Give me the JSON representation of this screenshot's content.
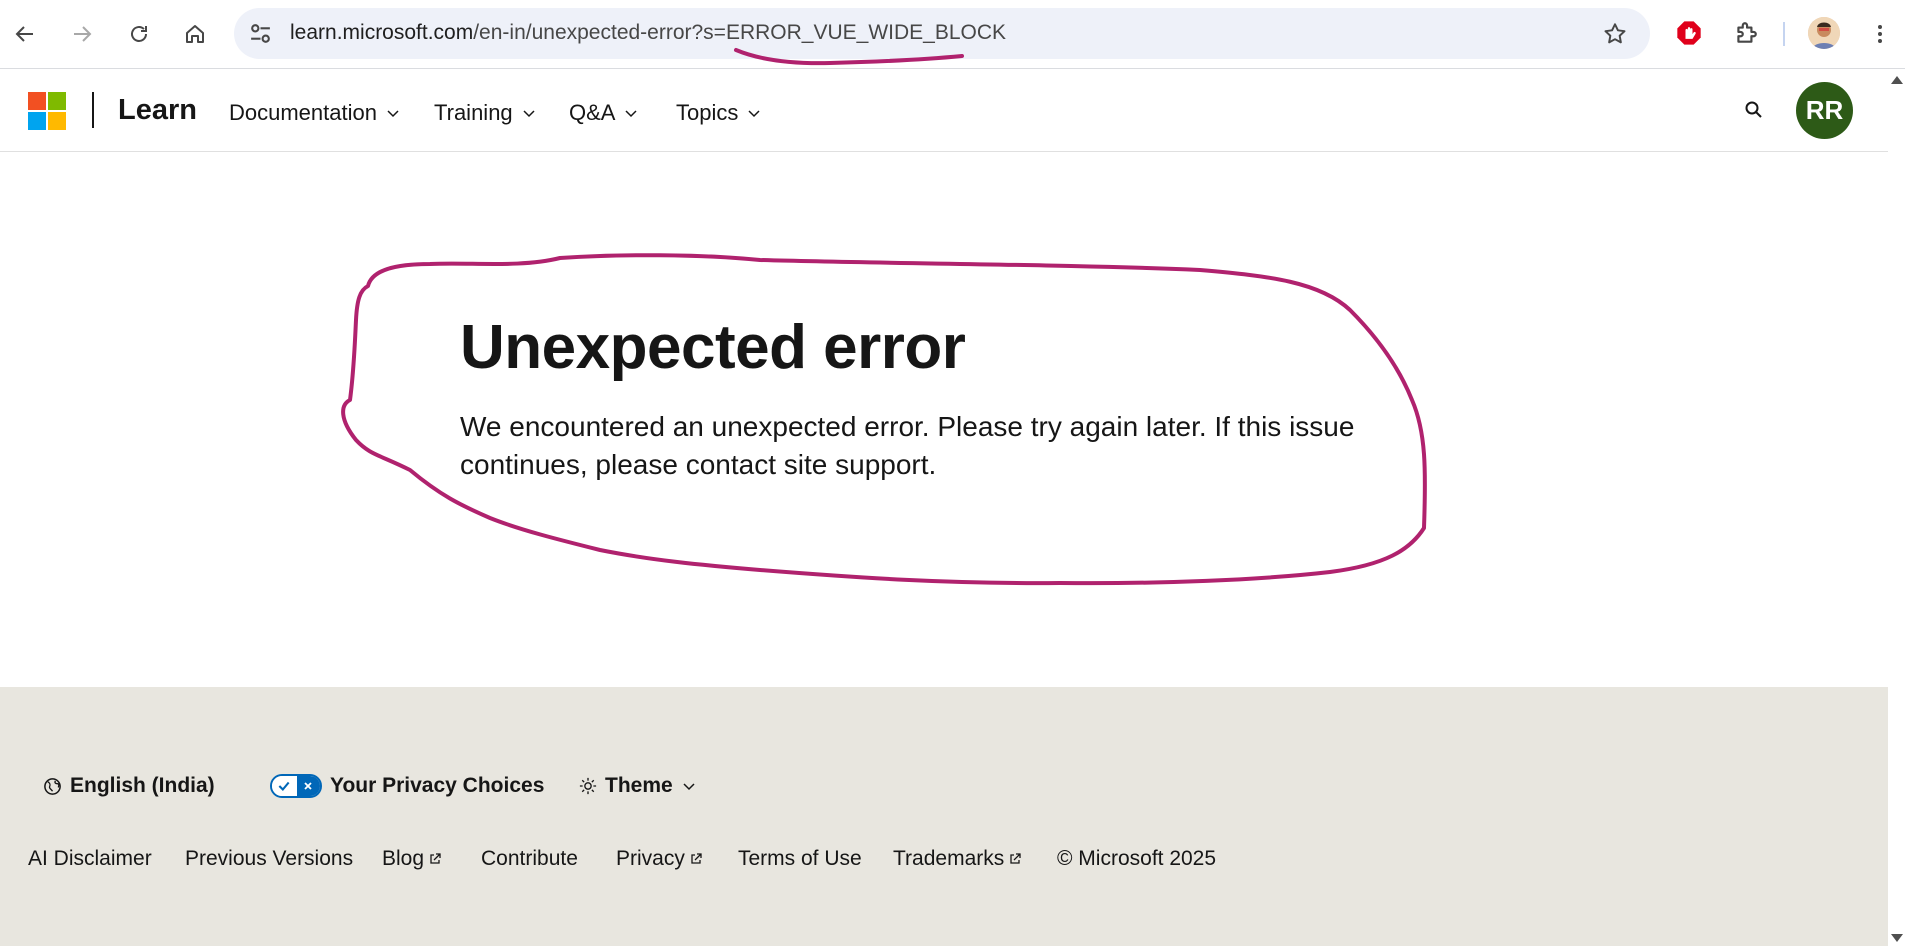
{
  "browser": {
    "url_host": "learn.microsoft.com",
    "url_path": "/en-in/unexpected-error?s=ERROR_VUE_WIDE_BLOCK",
    "icons": [
      "back-icon",
      "forward-icon",
      "reload-icon",
      "home-icon",
      "site-info-icon",
      "bookmark-star-icon",
      "adblock-extension-icon",
      "extensions-puzzle-icon",
      "profile-avatar",
      "more-menu-icon"
    ]
  },
  "header": {
    "brand": "Learn",
    "nav": [
      {
        "label": "Documentation"
      },
      {
        "label": "Training"
      },
      {
        "label": "Q&A"
      },
      {
        "label": "Topics"
      }
    ],
    "user_initials": "RR"
  },
  "main": {
    "title": "Unexpected error",
    "message": "We encountered an unexpected error. Please try again later. If this issue continues, please contact site support."
  },
  "footer": {
    "language": "English (India)",
    "privacy": "Your Privacy Choices",
    "theme": "Theme",
    "links": [
      {
        "label": "AI Disclaimer"
      },
      {
        "label": "Previous Versions"
      },
      {
        "label": "Blog"
      },
      {
        "label": "Contribute"
      },
      {
        "label": "Privacy"
      },
      {
        "label": "Terms of Use"
      },
      {
        "label": "Trademarks"
      }
    ],
    "copyright": "© Microsoft 2025"
  },
  "colors": {
    "annotation": "#b0226e",
    "footer_bg": "#e8e6df",
    "avatar_bg": "#2d5a17",
    "ms_red": "#f25022",
    "ms_green": "#7fba00",
    "ms_blue": "#00a4ef",
    "ms_yellow": "#ffb900"
  }
}
